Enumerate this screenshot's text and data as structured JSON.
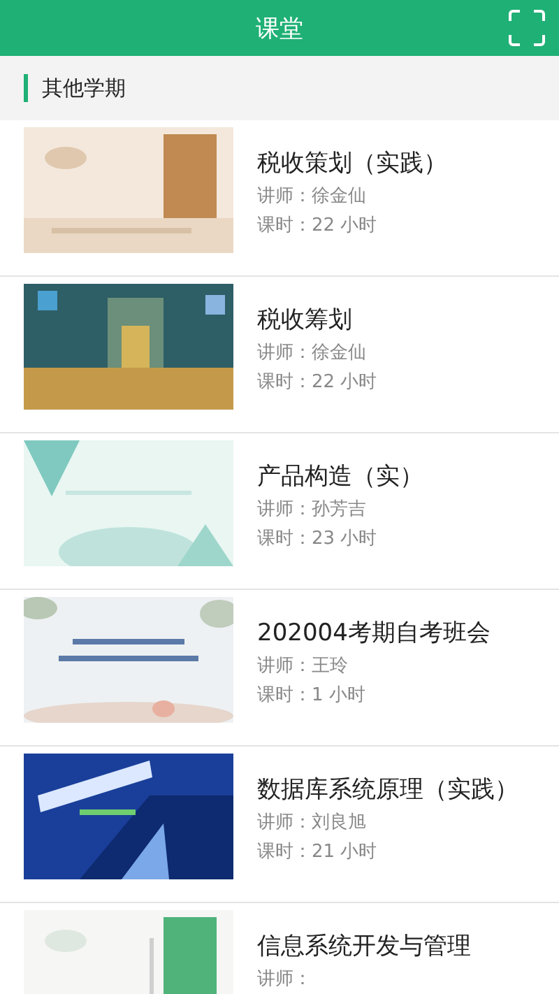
{
  "header": {
    "title": "课堂"
  },
  "section": {
    "title": "其他学期"
  },
  "courses": [
    {
      "title": "税收策划（实践）",
      "teacher": "讲师：徐金仙",
      "hours": "课时：22 小时"
    },
    {
      "title": "税收筹划",
      "teacher": "讲师：徐金仙",
      "hours": "课时：22 小时"
    },
    {
      "title": "产品构造（实）",
      "teacher": "讲师：孙芳吉",
      "hours": "课时：23 小时"
    },
    {
      "title": "202004考期自考班会",
      "teacher": "讲师：王玲",
      "hours": "课时：1 小时"
    },
    {
      "title": "数据库系统原理（实践）",
      "teacher": "讲师：刘良旭",
      "hours": "课时：21 小时"
    },
    {
      "title": "信息系统开发与管理",
      "teacher": "讲师："
    }
  ]
}
